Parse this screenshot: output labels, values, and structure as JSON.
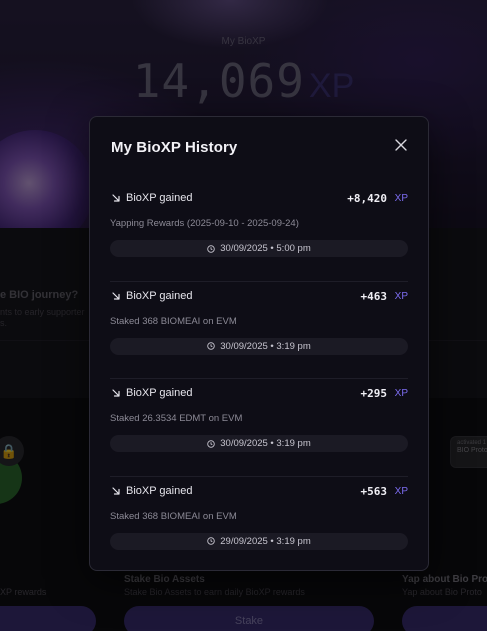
{
  "background": {
    "hero_label": "My BioXP",
    "points_value": "14,069",
    "points_unit": "XP",
    "question": "e BIO journey?",
    "sub_line1": "nts to early supporter",
    "sub_line2": "s.",
    "side_card_line1": "activated 1",
    "side_card_line2": "BIO Proto",
    "columns": [
      {
        "title": "",
        "subtitle": "XP rewards",
        "button": ""
      },
      {
        "title": "Stake Bio Assets",
        "subtitle": "Stake Bio Assets to earn daily BioXP rewards",
        "button": "Stake"
      },
      {
        "title": "Yap about Bio Proto",
        "subtitle": "Yap about Bio Proto",
        "button": ""
      }
    ]
  },
  "modal": {
    "title": "My BioXP History",
    "entries": [
      {
        "label": "BioXP gained",
        "amount": "+8,420",
        "unit": "XP",
        "description": "Yapping Rewards (2025-09-10 - 2025-09-24)",
        "timestamp": "30/09/2025 • 5:00 pm"
      },
      {
        "label": "BioXP gained",
        "amount": "+463",
        "unit": "XP",
        "description": "Staked 368 BIOMEAI on EVM",
        "timestamp": "30/09/2025 • 3:19 pm"
      },
      {
        "label": "BioXP gained",
        "amount": "+295",
        "unit": "XP",
        "description": "Staked 26.3534 EDMT on EVM",
        "timestamp": "30/09/2025 • 3:19 pm"
      },
      {
        "label": "BioXP gained",
        "amount": "+563",
        "unit": "XP",
        "description": "Staked 368 BIOMEAI on EVM",
        "timestamp": "29/09/2025 • 3:19 pm"
      }
    ]
  },
  "icons": {
    "close": "close-icon",
    "gain": "arrow-down-right-icon",
    "clock": "clock-icon",
    "lock": "lock-icon"
  },
  "colors": {
    "accent_xp": "#7c6cf0",
    "modal_bg": "#0e0d16",
    "button_bg": "#3b2f73"
  }
}
